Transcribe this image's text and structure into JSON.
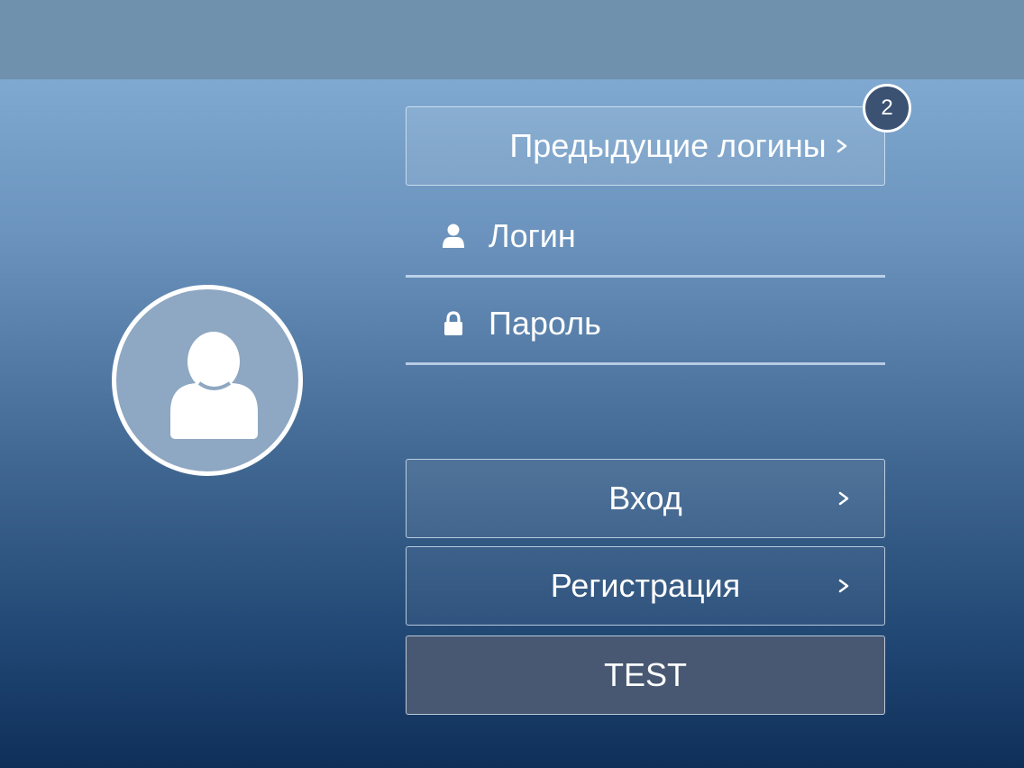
{
  "previous_logins": {
    "label": "Предыдущие логины",
    "count": "2",
    "icon": "chevron-right-icon"
  },
  "login_field": {
    "placeholder": "Логин",
    "value": "",
    "icon": "user-icon"
  },
  "password_field": {
    "placeholder": "Пароль",
    "value": "",
    "icon": "lock-icon"
  },
  "buttons": {
    "login": "Вход",
    "register": "Регистрация",
    "test": "TEST"
  },
  "avatar": {
    "icon": "user-avatar-icon"
  },
  "colors": {
    "top_bar": "#6f91ae",
    "background_top": "#7fa9d0",
    "background_bottom": "#0f2f59",
    "test_button": "#485872",
    "badge": "#3b5273"
  }
}
